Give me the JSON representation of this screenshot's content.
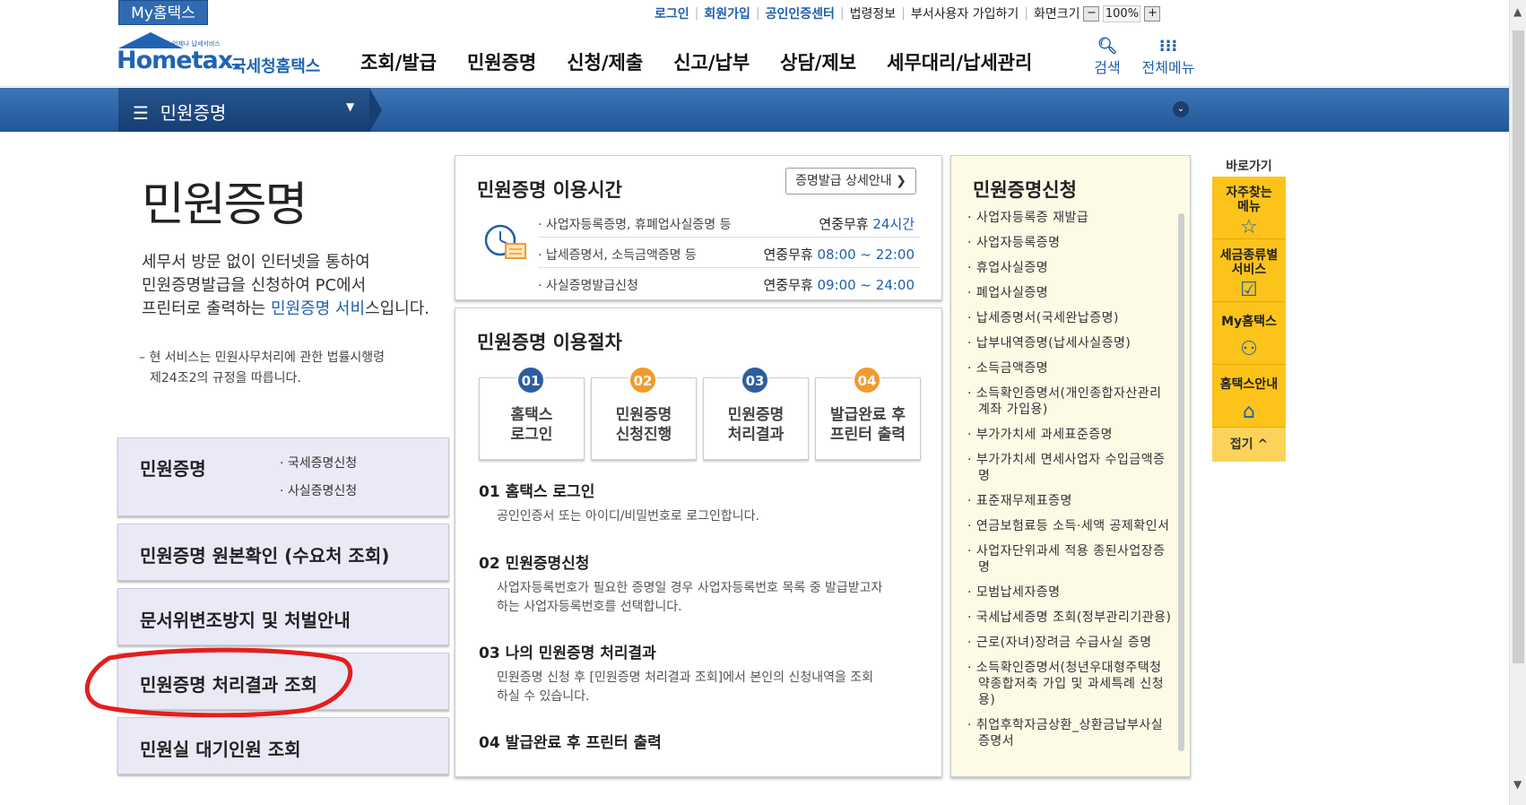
{
  "topbar": {
    "my_hometax": "My홈택스",
    "login": "로그인",
    "signup": "회원가입",
    "cert_center": "공인인증센터",
    "law_info": "법령정보",
    "dept_user": "부서사용자 가입하기",
    "screen_size": "화면크기",
    "zoom_minus": "−",
    "zoom_value": "100%",
    "zoom_plus": "+"
  },
  "header": {
    "logo_text": "Hometax.",
    "logo_kor": "국세청홈택스",
    "logo_small": "언제나 납세서비스",
    "gnb": [
      "조회/발급",
      "민원증명",
      "신청/제출",
      "신고/납부",
      "상담/제보",
      "세무대리/납세관리"
    ],
    "search_label": "검색",
    "all_menu_label": "전체메뉴"
  },
  "location_bar": {
    "current": "민원증명"
  },
  "intro": {
    "title": "민원증명",
    "line1": "세무서 방문 없이 인터넷을 통하여",
    "line2": "민원증명발급을 신청하여 PC에서",
    "line3_pre": "프린터로 출력하는 ",
    "line3_link": "민원증명 서비",
    "line3_post": "스입니다.",
    "note1": "– 현 서비스는 민원사무처리에 관한 법률시행령",
    "note2": "제24조2의 규정을 따릅니다."
  },
  "left_menu": {
    "box1_title": "민원증명",
    "box1_sub1": "· 국세증명신청",
    "box1_sub2": "· 사실증명신청",
    "box2_title": "민원증명 원본확인 (수요처 조회)",
    "box3_title": "문서위변조방지 및 처벌안내",
    "box4_title": "민원증명 처리결과 조회",
    "box5_title": "민원실 대기인원 조회"
  },
  "hours": {
    "title": "민원증명 이용시간",
    "detail_button": "증명발급 상세안내 ❯",
    "rows": [
      {
        "label": "· 사업자등록증명, 휴폐업사실증명 등",
        "pre": "연중무휴 ",
        "time": "24시간"
      },
      {
        "label": "· 납세증명서, 소득금액증명 등",
        "pre": "연중무휴 ",
        "time": "08:00 ~ 22:00"
      },
      {
        "label": "· 사실증명발급신청",
        "pre": "연중무휴 ",
        "time": "09:00 ~ 24:00"
      }
    ]
  },
  "procedure": {
    "title": "민원증명 이용절차",
    "steps": [
      {
        "num": "01",
        "label1": "홈택스",
        "label2": "로그인",
        "color": "#2b5ea0"
      },
      {
        "num": "02",
        "label1": "민원증명",
        "label2": "신청진행",
        "color": "#f29a2e"
      },
      {
        "num": "03",
        "label1": "민원증명",
        "label2": "처리결과",
        "color": "#2b5ea0"
      },
      {
        "num": "04",
        "label1": "발급완료 후",
        "label2": "프린터 출력",
        "color": "#f29a2e"
      }
    ],
    "desc": [
      {
        "head": "01 홈택스 로그인",
        "d1": "공인인증서 또는 아이디/비밀번호로 로그인합니다.",
        "d2": ""
      },
      {
        "head": "02 민원증명신청",
        "d1": "사업자등록번호가 필요한 증명일 경우 사업자등록번호 목록 중 발급받고자",
        "d2": "하는 사업자등록번호를 선택합니다."
      },
      {
        "head": "03 나의 민원증명 처리결과",
        "d1": "민원증명 신청 후 [민원증명 처리결과 조회]에서 본인의 신청내역을 조회",
        "d2": "하실 수 있습니다."
      },
      {
        "head": "04 발급완료 후 프린터 출력",
        "d1": "",
        "d2": ""
      }
    ]
  },
  "apply": {
    "title": "민원증명신청",
    "items": [
      "· 사업자등록증 재발급",
      "· 사업자등록증명",
      "· 휴업사실증명",
      "· 폐업사실증명",
      "· 납세증명서(국세완납증명)",
      "· 납부내역증명(납세사실증명)",
      "· 소득금액증명",
      "· 소득확인증명서(개인종합자산관리계좌 가입용)",
      "· 부가가치세 과세표준증명",
      "· 부가가치세 면세사업자 수입금액증명",
      "· 표준재무제표증명",
      "· 연금보험료등 소득·세액 공제확인서",
      "· 사업자단위과세 적용 종된사업장증명",
      "· 모범납세자증명",
      "· 국세납세증명 조회(정부관리기관용)",
      "· 근로(자녀)장려금 수급사실 증명",
      "· 소득확인증명서(청년우대형주택청약종합저축 가입 및 과세특례 신청용)",
      "· 취업후학자금상환_상환금납부사실증명서"
    ]
  },
  "quick": {
    "head": "바로가기",
    "items": [
      {
        "l1": "자주찾는",
        "l2": "메뉴",
        "icon": "☆"
      },
      {
        "l1": "세금종류별",
        "l2": "서비스",
        "icon": "☑"
      },
      {
        "l1": "My홈택스",
        "l2": "",
        "icon": "⚇"
      },
      {
        "l1": "홈택스안내",
        "l2": "",
        "icon": "⌂"
      }
    ],
    "fold": "접기 ^"
  }
}
